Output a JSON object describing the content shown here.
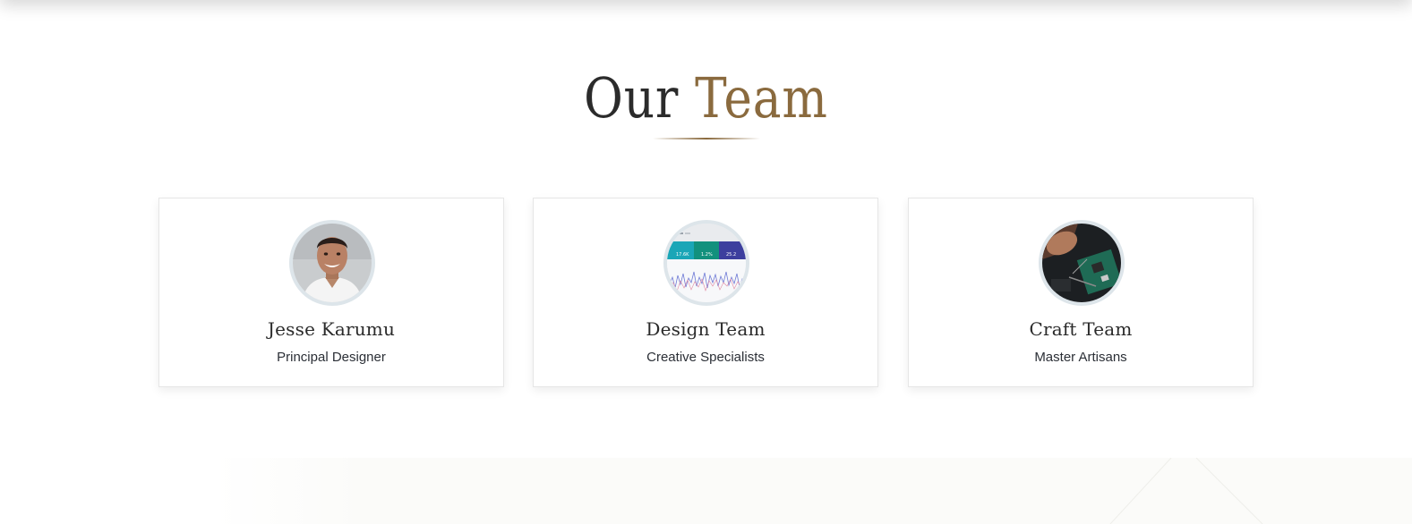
{
  "section": {
    "title_part1": "Our",
    "title_part2": "Team",
    "title_color": "#2b2b2b",
    "accent_color": "#8a6a3e"
  },
  "team": [
    {
      "name": "Jesse Karumu",
      "role": "Principal Designer",
      "image": "portrait-photo"
    },
    {
      "name": "Design Team",
      "role": "Creative Specialists",
      "image": "analytics-dashboard-photo",
      "dashboard_stats": [
        "17.6K",
        "1.2%",
        "25.2"
      ]
    },
    {
      "name": "Craft Team",
      "role": "Master Artisans",
      "image": "circuit-board-photo"
    }
  ]
}
